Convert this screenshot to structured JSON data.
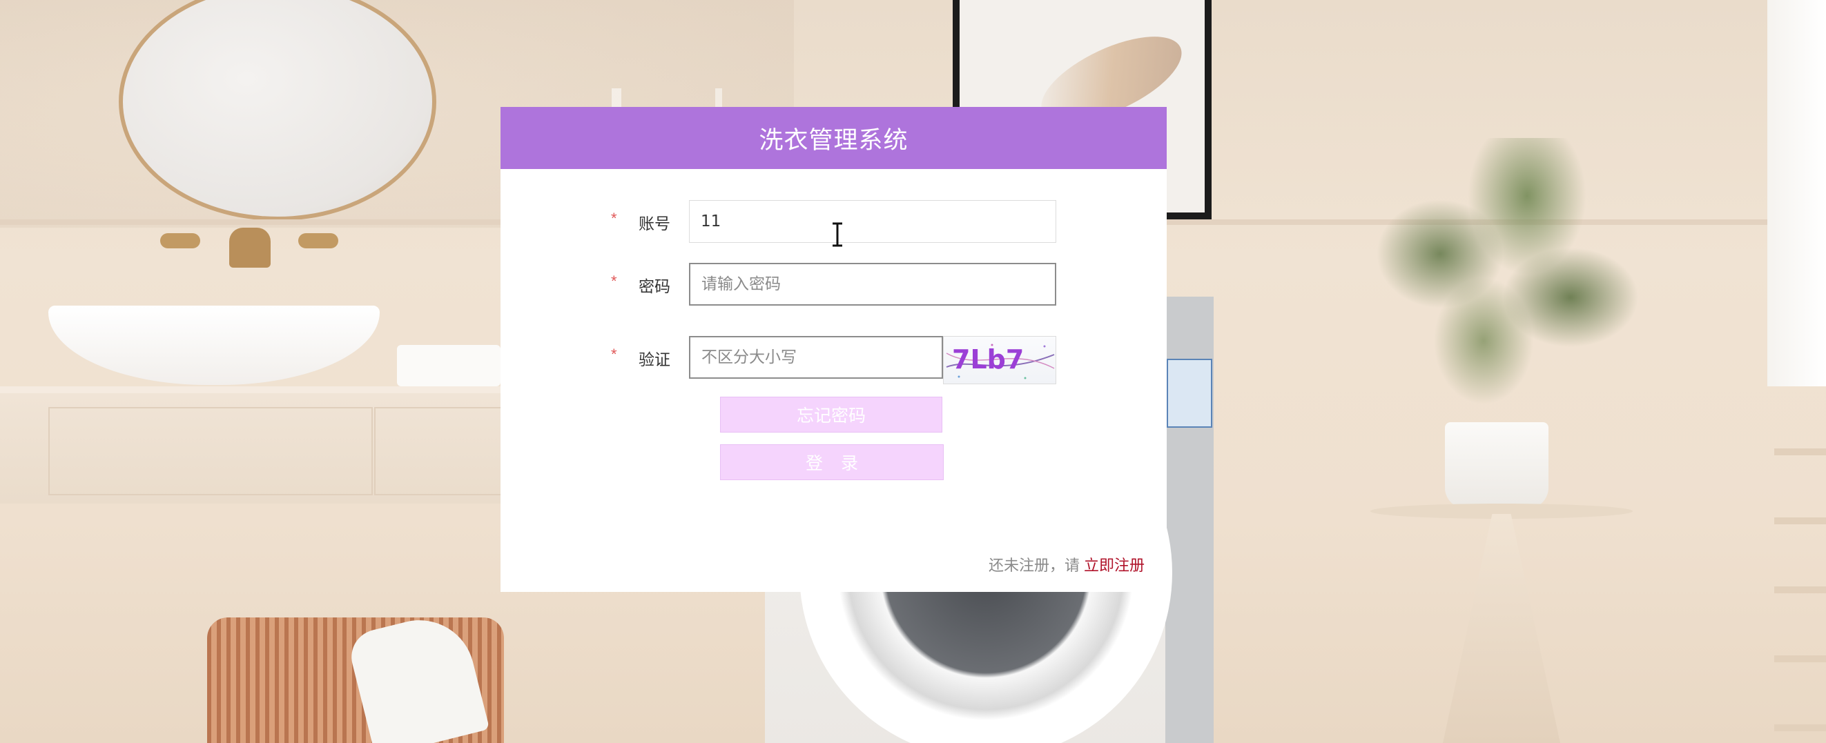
{
  "app": {
    "title": "洗衣管理系统"
  },
  "form": {
    "required_mark": "*",
    "account": {
      "label": "账号",
      "value": "11",
      "placeholder": ""
    },
    "password": {
      "label": "密码",
      "value": "",
      "placeholder": "请输入密码"
    },
    "captcha": {
      "label": "验证",
      "value": "",
      "placeholder": "不区分大小写",
      "code_text": "7Lb7"
    }
  },
  "buttons": {
    "forgot_password": "忘记密码",
    "login": "登录"
  },
  "footer": {
    "register_prompt": "还未注册，请",
    "register_link": "立即注册"
  },
  "colors": {
    "header": "#ae74dc",
    "button_bg": "#f5d4fd",
    "required": "#e05858",
    "register_link": "#b0132a"
  }
}
